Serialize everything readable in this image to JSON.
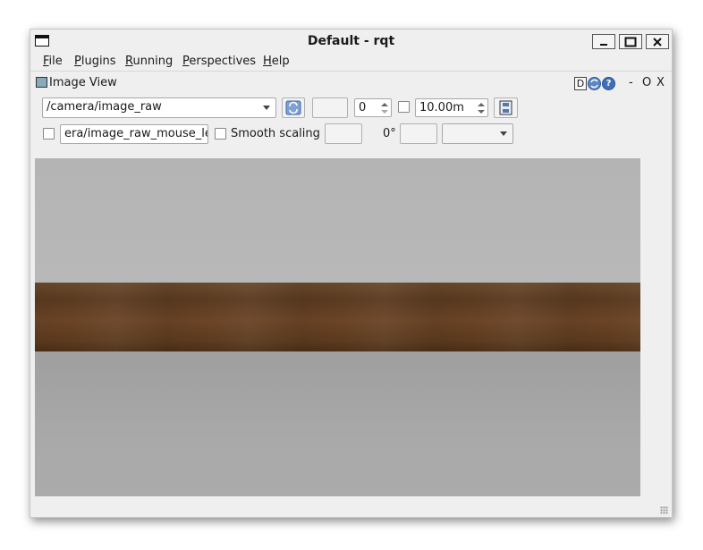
{
  "window": {
    "title": "Default - rqt"
  },
  "menubar": {
    "items": [
      "File",
      "Plugins",
      "Running",
      "Perspectives",
      "Help"
    ]
  },
  "dock": {
    "title": "Image View",
    "d_label": "D",
    "minimize_label": "-",
    "float_label": "O",
    "close_label": "X"
  },
  "toolbar": {
    "topic_selected": "/camera/image_raw",
    "zoom_value": "0",
    "max_range_value": "10.00m",
    "mouse_topic_value": "era/image_raw_mouse_left",
    "smooth_scaling_label": "Smooth scaling",
    "smooth_scaling_checked": false,
    "rotation_label": "0°"
  },
  "colors": {
    "window_bg": "#efefef",
    "wood": "#5f3f24",
    "wall": "#b4b4b4",
    "floor": "#a6a6a6"
  }
}
